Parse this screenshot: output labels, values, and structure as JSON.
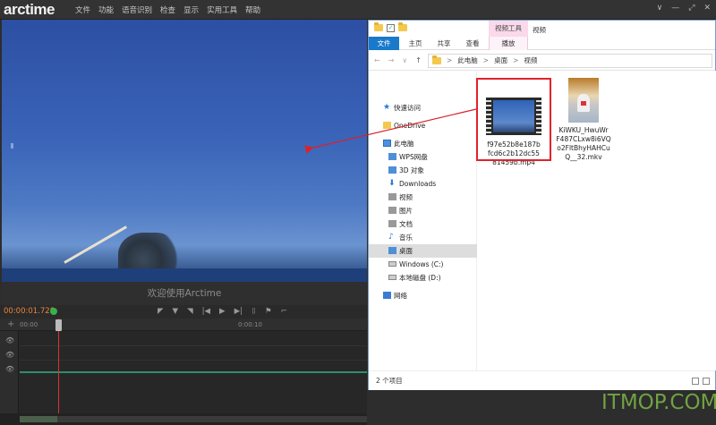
{
  "app": {
    "logo_prefix": "arc",
    "logo_suffix": "time",
    "menu": [
      "文件",
      "功能",
      "语音识别",
      "检查",
      "显示",
      "实用工具",
      "帮助"
    ],
    "window_controls": [
      "∨",
      "—",
      "⤢",
      "✕"
    ]
  },
  "player": {
    "welcome_text": "欢迎使用Arctime",
    "timecode": "00:00:01.728",
    "transport_icons": [
      "◤",
      "▼",
      "◥",
      "|◀",
      "▶",
      "▶|",
      "⌷",
      "⚑",
      "⌐"
    ]
  },
  "timeline": {
    "plus": "+",
    "tick_start": "00:00",
    "tick_mid": "0:00:10",
    "eye_icon": "👁"
  },
  "explorer": {
    "context_group": "视频工具",
    "title": "视频",
    "tabs": {
      "file": "文件",
      "home": "主页",
      "share": "共享",
      "view": "查看",
      "play": "播放"
    },
    "nav_back": "←",
    "nav_forward": "→",
    "nav_down": "∨",
    "nav_up": "↑",
    "path": [
      "此电脑",
      "桌面",
      "视频"
    ],
    "path_sep": ">",
    "nav_items": [
      {
        "label": "快速访问"
      },
      {
        "label": "OneDrive"
      },
      {
        "label": "此电脑"
      },
      {
        "label": "WPS网盘"
      },
      {
        "label": "3D 对象"
      },
      {
        "label": "Downloads"
      },
      {
        "label": "视频"
      },
      {
        "label": "图片"
      },
      {
        "label": "文档"
      },
      {
        "label": "音乐"
      },
      {
        "label": "桌面"
      },
      {
        "label": "Windows (C:)"
      },
      {
        "label": "本地磁盘 (D:)"
      },
      {
        "label": "网络"
      }
    ],
    "files": [
      {
        "name_lines": [
          "f97e52b8e187b",
          "fcd6c2b12dc55",
          "81459b.mp4"
        ]
      },
      {
        "name_lines": [
          "KiWKU_HwuWr",
          "F487CLxw8i6VQ",
          "o2FltBhyHAHCu",
          "Q__32.mkv"
        ]
      }
    ],
    "status": "2 个项目"
  },
  "watermark": {
    "text_a": "ITMOP",
    "text_dot": ".",
    "text_b": "COM"
  },
  "colors": {
    "accent_orange": "#e9843a",
    "highlight_red": "#e0232b",
    "file_tab_blue": "#1979ca",
    "context_pink": "#f9d9ea",
    "watermark_green": "#78af46"
  }
}
